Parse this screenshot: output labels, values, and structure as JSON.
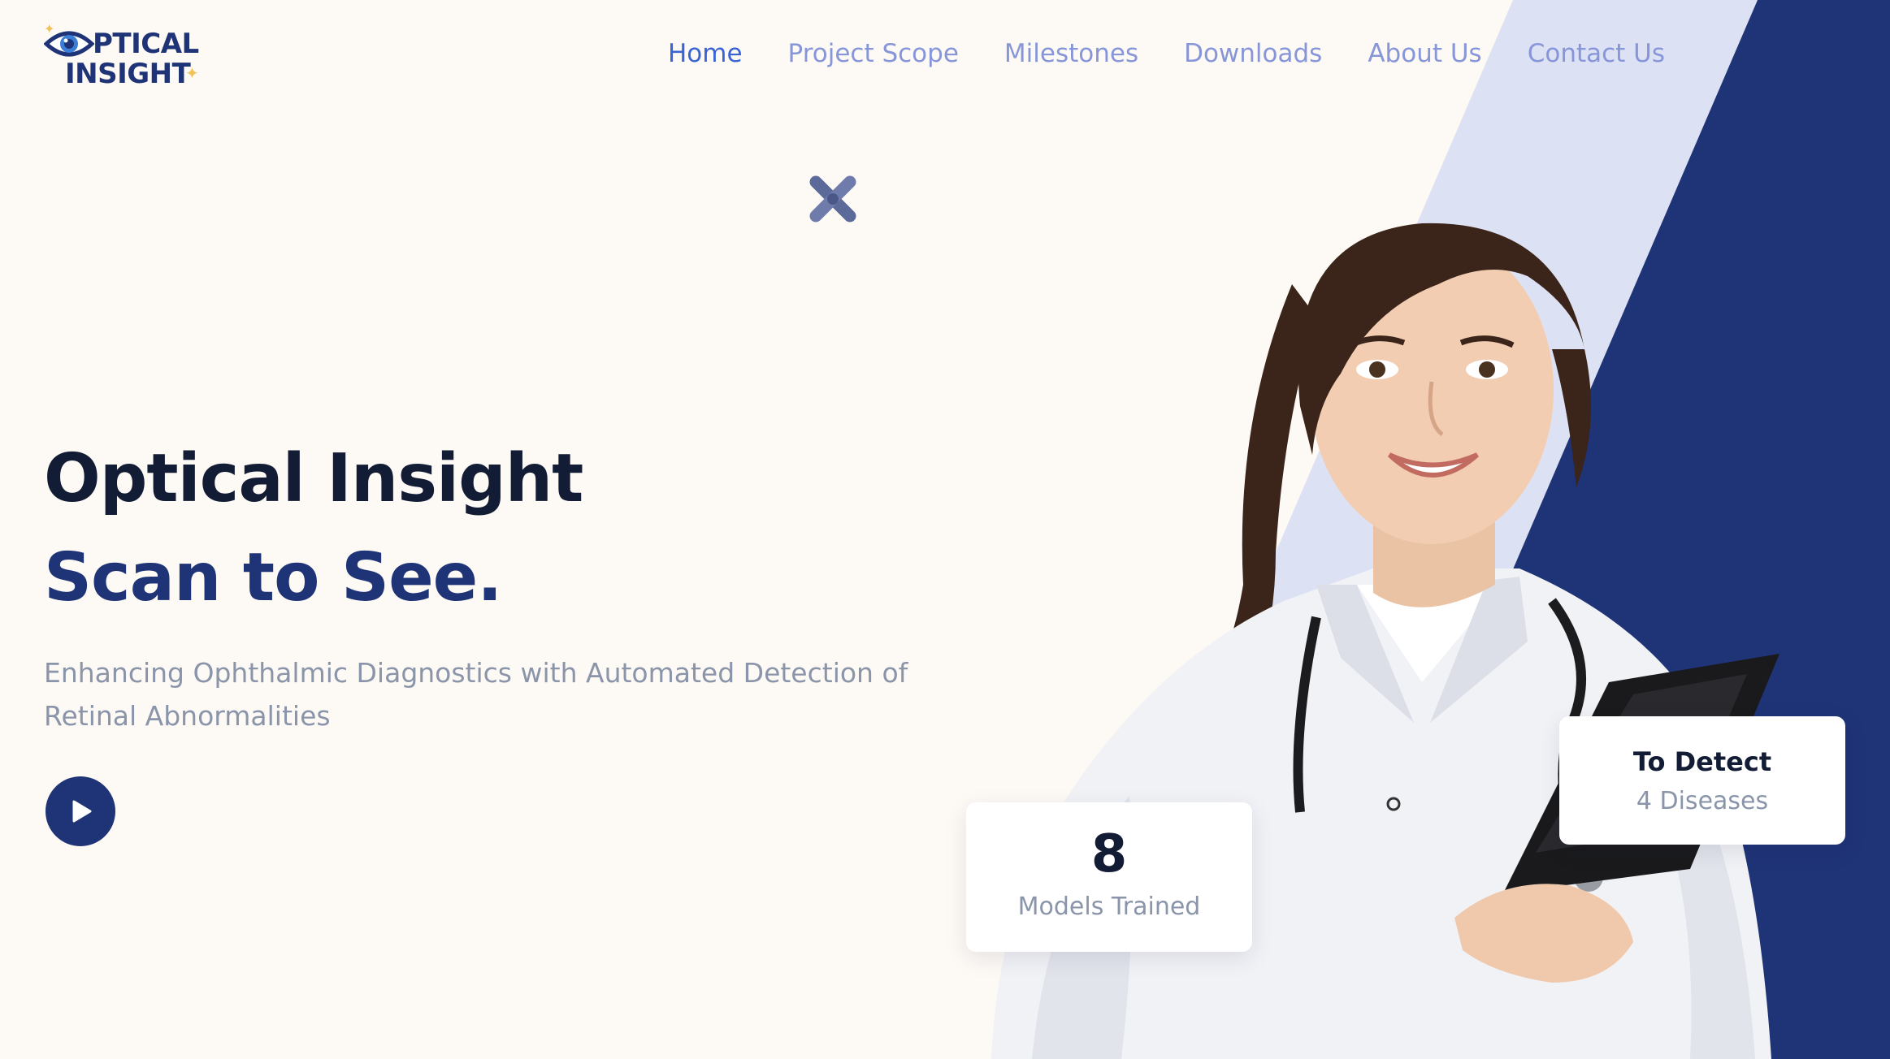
{
  "brand": {
    "name_line1": "PTICAL",
    "name_line2": "INSIGHT",
    "colors": {
      "navy": "#1f3377",
      "accent": "#3a63d4",
      "nav_link": "#8796d9",
      "stripe_light": "#dde1f4",
      "star": "#f1c257"
    }
  },
  "nav": {
    "items": [
      {
        "label": "Home",
        "active": true
      },
      {
        "label": "Project Scope",
        "active": false
      },
      {
        "label": "Milestones",
        "active": false
      },
      {
        "label": "Downloads",
        "active": false
      },
      {
        "label": "About Us",
        "active": false
      },
      {
        "label": "Contact Us",
        "active": false
      }
    ]
  },
  "hero": {
    "title": "Optical Insight",
    "subtitle": "Scan to See.",
    "description": "Enhancing Ophthalmic Diagnostics with Automated Detection of Retinal Abnormalities",
    "play_icon": "play-icon"
  },
  "stats": {
    "models": {
      "number": "8",
      "label": "Models Trained"
    },
    "detect": {
      "heading": "To Detect",
      "sub": "4 Diseases"
    }
  }
}
